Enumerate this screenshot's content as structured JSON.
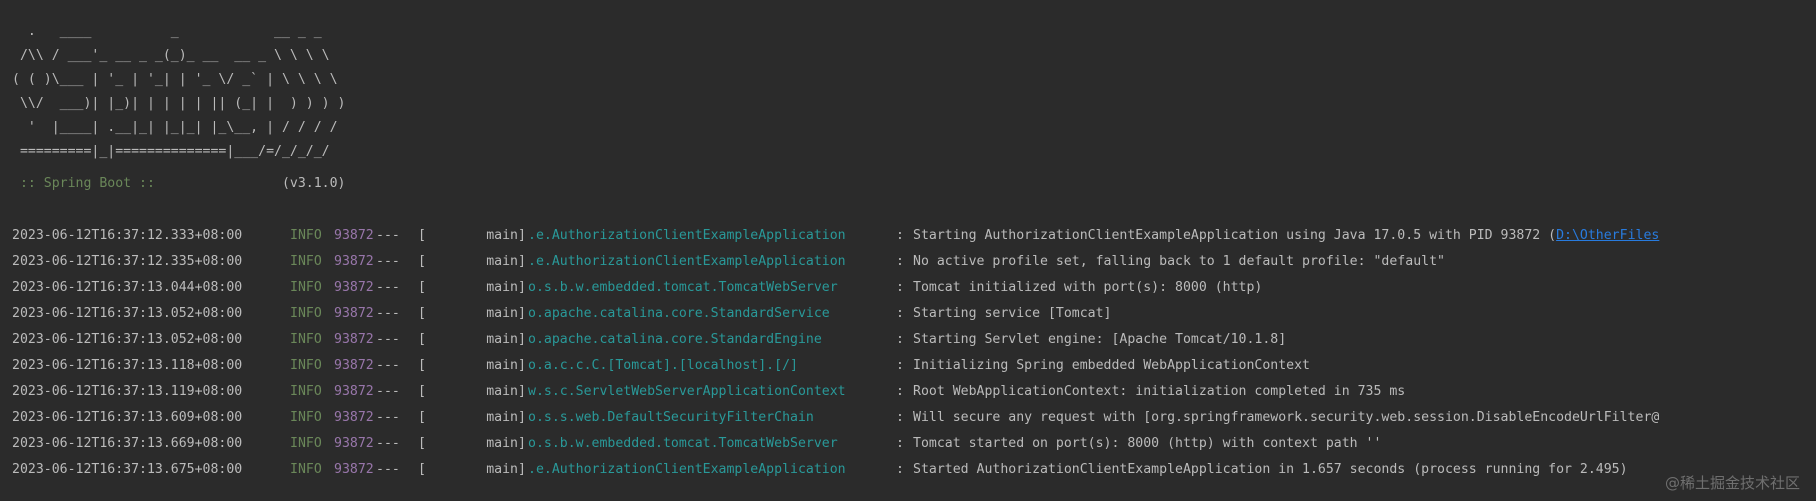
{
  "colors": {
    "background": "#2b2b2b",
    "text": "#bbbbbb",
    "info_level": "#6a8759",
    "pid": "#9876aa",
    "logger": "#299999",
    "link": "#287bde"
  },
  "banner": {
    "ascii_art": "  .   ____          _            __ _ _\n /\\\\ / ___'_ __ _ _(_)_ __  __ _ \\ \\ \\ \\\n( ( )\\___ | '_ | '_| | '_ \\/ _` | \\ \\ \\ \\\n \\\\/  ___)| |_)| | | | | || (_| |  ) ) ) )\n  '  |____| .__|_| |_|_| |_\\__, | / / / /\n =========|_|==============|___/=/_/_/_/",
    "boot_label": " :: Spring Boot :: ",
    "boot_version": "               (v3.1.0)"
  },
  "logs": [
    {
      "ts": "2023-06-12T16:37:12.333+08:00",
      "level": "INFO",
      "pid": "93872",
      "sep": "---",
      "thread": "main",
      "logger": ".e.AuthorizationClientExampleApplication",
      "message": "Starting AuthorizationClientExampleApplication using Java 17.0.5 with PID 93872 (",
      "link": "D:\\OtherFiles"
    },
    {
      "ts": "2023-06-12T16:37:12.335+08:00",
      "level": "INFO",
      "pid": "93872",
      "sep": "---",
      "thread": "main",
      "logger": ".e.AuthorizationClientExampleApplication",
      "message": "No active profile set, falling back to 1 default profile: \"default\"",
      "link": ""
    },
    {
      "ts": "2023-06-12T16:37:13.044+08:00",
      "level": "INFO",
      "pid": "93872",
      "sep": "---",
      "thread": "main",
      "logger": "o.s.b.w.embedded.tomcat.TomcatWebServer",
      "message": "Tomcat initialized with port(s): 8000 (http)",
      "link": ""
    },
    {
      "ts": "2023-06-12T16:37:13.052+08:00",
      "level": "INFO",
      "pid": "93872",
      "sep": "---",
      "thread": "main",
      "logger": "o.apache.catalina.core.StandardService",
      "message": "Starting service [Tomcat]",
      "link": ""
    },
    {
      "ts": "2023-06-12T16:37:13.052+08:00",
      "level": "INFO",
      "pid": "93872",
      "sep": "---",
      "thread": "main",
      "logger": "o.apache.catalina.core.StandardEngine",
      "message": "Starting Servlet engine: [Apache Tomcat/10.1.8]",
      "link": ""
    },
    {
      "ts": "2023-06-12T16:37:13.118+08:00",
      "level": "INFO",
      "pid": "93872",
      "sep": "---",
      "thread": "main",
      "logger": "o.a.c.c.C.[Tomcat].[localhost].[/]",
      "message": "Initializing Spring embedded WebApplicationContext",
      "link": ""
    },
    {
      "ts": "2023-06-12T16:37:13.119+08:00",
      "level": "INFO",
      "pid": "93872",
      "sep": "---",
      "thread": "main",
      "logger": "w.s.c.ServletWebServerApplicationContext",
      "message": "Root WebApplicationContext: initialization completed in 735 ms",
      "link": ""
    },
    {
      "ts": "2023-06-12T16:37:13.609+08:00",
      "level": "INFO",
      "pid": "93872",
      "sep": "---",
      "thread": "main",
      "logger": "o.s.s.web.DefaultSecurityFilterChain",
      "message": "Will secure any request with [org.springframework.security.web.session.DisableEncodeUrlFilter@",
      "link": ""
    },
    {
      "ts": "2023-06-12T16:37:13.669+08:00",
      "level": "INFO",
      "pid": "93872",
      "sep": "---",
      "thread": "main",
      "logger": "o.s.b.w.embedded.tomcat.TomcatWebServer",
      "message": "Tomcat started on port(s): 8000 (http) with context path ''",
      "link": ""
    },
    {
      "ts": "2023-06-12T16:37:13.675+08:00",
      "level": "INFO",
      "pid": "93872",
      "sep": "---",
      "thread": "main",
      "logger": ".e.AuthorizationClientExampleApplication",
      "message": "Started AuthorizationClientExampleApplication in 1.657 seconds (process running for 2.495)",
      "link": ""
    }
  ],
  "watermark": "@稀土掘金技术社区"
}
